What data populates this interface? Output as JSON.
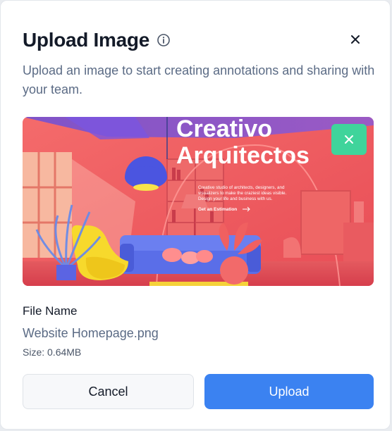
{
  "dialog": {
    "title": "Upload Image",
    "subtitle": "Upload an image to start creating annotations and sharing with your team."
  },
  "preview": {
    "headline_line1": "Creativo",
    "headline_line2": "Arquitectos",
    "body_line1": "Creative studio of architects, designers, and",
    "body_line2": "visualizers to make the craziest ideas visible.",
    "body_line3": "Design your life and business with us.",
    "cta": "Get an Estimation"
  },
  "file": {
    "label": "File Name",
    "name": "Website Homepage.png",
    "size": "Size: 0.64MB"
  },
  "actions": {
    "cancel": "Cancel",
    "upload": "Upload"
  },
  "colors": {
    "primary": "#3b82f1",
    "remove_button": "#3fd49b",
    "title": "#131a28",
    "muted": "#5b6b85"
  },
  "icons": {
    "info": "info-icon",
    "close": "close-icon",
    "remove": "x-icon"
  }
}
